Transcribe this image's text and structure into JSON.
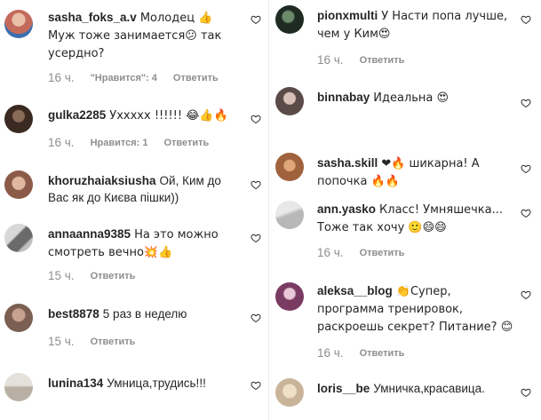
{
  "colors": {
    "text": "#262626",
    "secondary": "#8e8e8e",
    "divider": "#efefef"
  },
  "left_comments": [
    {
      "username": "sasha_foks_a.v",
      "text": "Молодец 👍 Муж тоже занимается😕 так усердно?",
      "time": "16 ч.",
      "likes": "\"Нравится\": 4",
      "reply": "Ответить",
      "avatar_color": "#c46a5a"
    },
    {
      "username": "gulka2285",
      "text": "Ухxxxx !!!!!! 😂👍🔥",
      "time": "16 ч.",
      "likes": "Нравится: 1",
      "reply": "Ответить",
      "avatar_color": "#3b2a22"
    },
    {
      "username": "khoruzhaiaksiusha",
      "text": "Ой, Ким до Вас як до Києва пішки))",
      "time": "",
      "likes": "",
      "reply": "",
      "avatar_color": "#8c5a48"
    },
    {
      "username": "annaanna9385",
      "text": "На это можно смотреть вечно💥👍",
      "time": "15 ч.",
      "likes": "",
      "reply": "Ответить",
      "avatar_color": "#9a9a9a"
    },
    {
      "username": "best8878",
      "text": "5 раз в неделю",
      "time": "15 ч.",
      "likes": "",
      "reply": "Ответить",
      "avatar_color": "#7a5f52"
    },
    {
      "username": "lunina134",
      "text": "Умница,трудись!!!",
      "time": "",
      "likes": "",
      "reply": "",
      "avatar_color": "#b8b0a4"
    }
  ],
  "right_comments": [
    {
      "username": "pionxmulti",
      "text": "У Насти попа лучше, чем у Ким😍",
      "time": "16 ч.",
      "likes": "",
      "reply": "Ответить",
      "avatar_color": "#1f2a22"
    },
    {
      "username": "binnabay",
      "text": "Идеальна 😍",
      "time": "",
      "likes": "",
      "reply": "",
      "avatar_color": "#5a4a48"
    },
    {
      "username": "sasha.skill",
      "text": "❤🔥 шикарна! А попочка 🔥🔥",
      "time": "",
      "likes": "",
      "reply": "",
      "avatar_color": "#a0623c"
    },
    {
      "username": "ann.yasko",
      "text": "Класс! Умняшечка... Тоже так хочу 🙂😄😄",
      "time": "16 ч.",
      "likes": "",
      "reply": "Ответить",
      "avatar_color": "#b8b8b8"
    },
    {
      "username": "aleksa__blog",
      "text": "👏Супер, программа тренировок, раскроешь секрет? Питание? 😊",
      "time": "16 ч.",
      "likes": "",
      "reply": "Ответить",
      "avatar_color": "#7a3b62"
    },
    {
      "username": "loris__be",
      "text": "Умничка,красавица.",
      "time": "",
      "likes": "",
      "reply": "",
      "avatar_color": "#c9b49a"
    }
  ]
}
